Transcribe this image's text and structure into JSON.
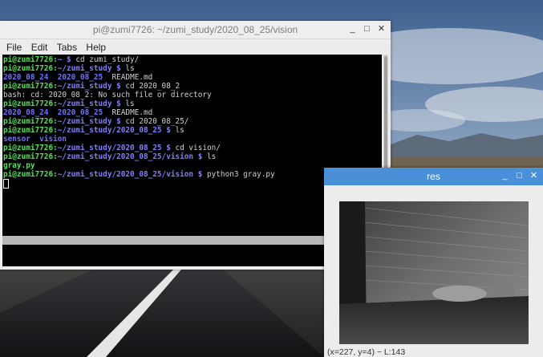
{
  "terminal": {
    "title": "pi@zumi7726: ~/zumi_study/2020_08_25/vision",
    "window_buttons": [
      "_",
      "□",
      "✕"
    ],
    "menu": [
      "File",
      "Edit",
      "Tabs",
      "Help"
    ],
    "lines": [
      [
        {
          "t": "pi@zumi7726:",
          "c": "p-user"
        },
        {
          "t": "~ $ ",
          "c": "p-path"
        },
        {
          "t": "cd zumi_study/",
          "c": ""
        }
      ],
      [
        {
          "t": "pi@zumi7726:",
          "c": "p-user"
        },
        {
          "t": "~/zumi_study $ ",
          "c": "p-path"
        },
        {
          "t": "ls",
          "c": ""
        }
      ],
      [
        {
          "t": "2020_08_24",
          "c": "dir"
        },
        {
          "t": "  ",
          "c": ""
        },
        {
          "t": "2020_08_25",
          "c": "dir"
        },
        {
          "t": "  README.md",
          "c": ""
        }
      ],
      [
        {
          "t": "pi@zumi7726:",
          "c": "p-user"
        },
        {
          "t": "~/zumi_study $ ",
          "c": "p-path"
        },
        {
          "t": "cd 2020_08_2",
          "c": ""
        }
      ],
      [
        {
          "t": "bash: cd: 2020_08_2: No such file or directory",
          "c": ""
        }
      ],
      [
        {
          "t": "pi@zumi7726:",
          "c": "p-user"
        },
        {
          "t": "~/zumi_study $ ",
          "c": "p-path"
        },
        {
          "t": "ls",
          "c": ""
        }
      ],
      [
        {
          "t": "2020_08_24",
          "c": "dir"
        },
        {
          "t": "  ",
          "c": ""
        },
        {
          "t": "2020_08_25",
          "c": "dir"
        },
        {
          "t": "  README.md",
          "c": ""
        }
      ],
      [
        {
          "t": "pi@zumi7726:",
          "c": "p-user"
        },
        {
          "t": "~/zumi_study $ ",
          "c": "p-path"
        },
        {
          "t": "cd 2020_08_25/",
          "c": ""
        }
      ],
      [
        {
          "t": "pi@zumi7726:",
          "c": "p-user"
        },
        {
          "t": "~/zumi_study/2020_08_25 $ ",
          "c": "p-path"
        },
        {
          "t": "ls",
          "c": ""
        }
      ],
      [
        {
          "t": "sensor",
          "c": "dir"
        },
        {
          "t": "  ",
          "c": ""
        },
        {
          "t": "vision",
          "c": "dir"
        }
      ],
      [
        {
          "t": "pi@zumi7726:",
          "c": "p-user"
        },
        {
          "t": "~/zumi_study/2020_08_25 $ ",
          "c": "p-path"
        },
        {
          "t": "cd vision/",
          "c": ""
        }
      ],
      [
        {
          "t": "pi@zumi7726:",
          "c": "p-user"
        },
        {
          "t": "~/zumi_study/2020_08_25/vision $ ",
          "c": "p-path"
        },
        {
          "t": "ls",
          "c": ""
        }
      ],
      [
        {
          "t": "gray.py",
          "c": "file"
        }
      ],
      [
        {
          "t": "pi@zumi7726:",
          "c": "p-user"
        },
        {
          "t": "~/zumi_study/2020_08_25/vision $ ",
          "c": "p-path"
        },
        {
          "t": "python3 gray.py",
          "c": ""
        }
      ]
    ]
  },
  "res_window": {
    "title": "res",
    "window_buttons": [
      "_",
      "□",
      "✕"
    ],
    "status": "(x=227, y=4) ~ L:143"
  },
  "colors": {
    "prompt_user": "#55e05a",
    "prompt_path": "#7f7ffb",
    "res_titlebar": "#4a90d9"
  }
}
